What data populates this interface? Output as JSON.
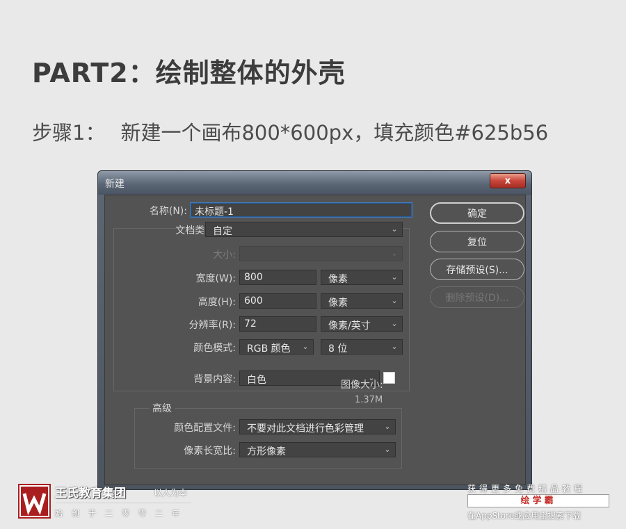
{
  "page": {
    "heading": "PART2：绘制整体的外壳",
    "step_label": "步骤1：",
    "step_text": "新建一个画布800*600px，填充颜色#625b56"
  },
  "dialog": {
    "title": "新建",
    "close_symbol": "x",
    "fields": {
      "name_label": "名称(N):",
      "name_value": "未标题-1",
      "doc_type_label": "文档类型:",
      "doc_type_value": "自定",
      "size_label": "大小:",
      "size_value": "",
      "width_label": "宽度(W):",
      "width_value": "800",
      "width_unit": "像素",
      "height_label": "高度(H):",
      "height_value": "600",
      "height_unit": "像素",
      "resolution_label": "分辨率(R):",
      "resolution_value": "72",
      "resolution_unit": "像素/英寸",
      "color_mode_label": "颜色模式:",
      "color_mode_value": "RGB 颜色",
      "bit_depth_value": "8 位",
      "background_label": "背景内容:",
      "background_value": "白色"
    },
    "advanced": {
      "title": "高级",
      "color_profile_label": "颜色配置文件:",
      "color_profile_value": "不要对此文档进行色彩管理",
      "pixel_aspect_label": "像素长宽比:",
      "pixel_aspect_value": "方形像素"
    },
    "buttons": {
      "ok": "确定",
      "reset": "复位",
      "save_preset": "存储预设(S)...",
      "delete_preset": "删除预设(D)..."
    },
    "image_size_label": "图像大小:",
    "image_size_value": "1.37M"
  },
  "footer": {
    "brand_name": "王氏教育集团",
    "brand_tagline": "以人为本",
    "brand_sub": "始创于二零零二年",
    "promo_top": "获得更多免费精品教程",
    "promo_app": "绘学霸",
    "promo_bottom": "在AppStore或应用宝搜索下载"
  },
  "colors": {
    "panel_bg": "#535353",
    "input_bg": "#434343",
    "active_border": "#3e7cc4",
    "logo_red": "#a91f1f"
  }
}
